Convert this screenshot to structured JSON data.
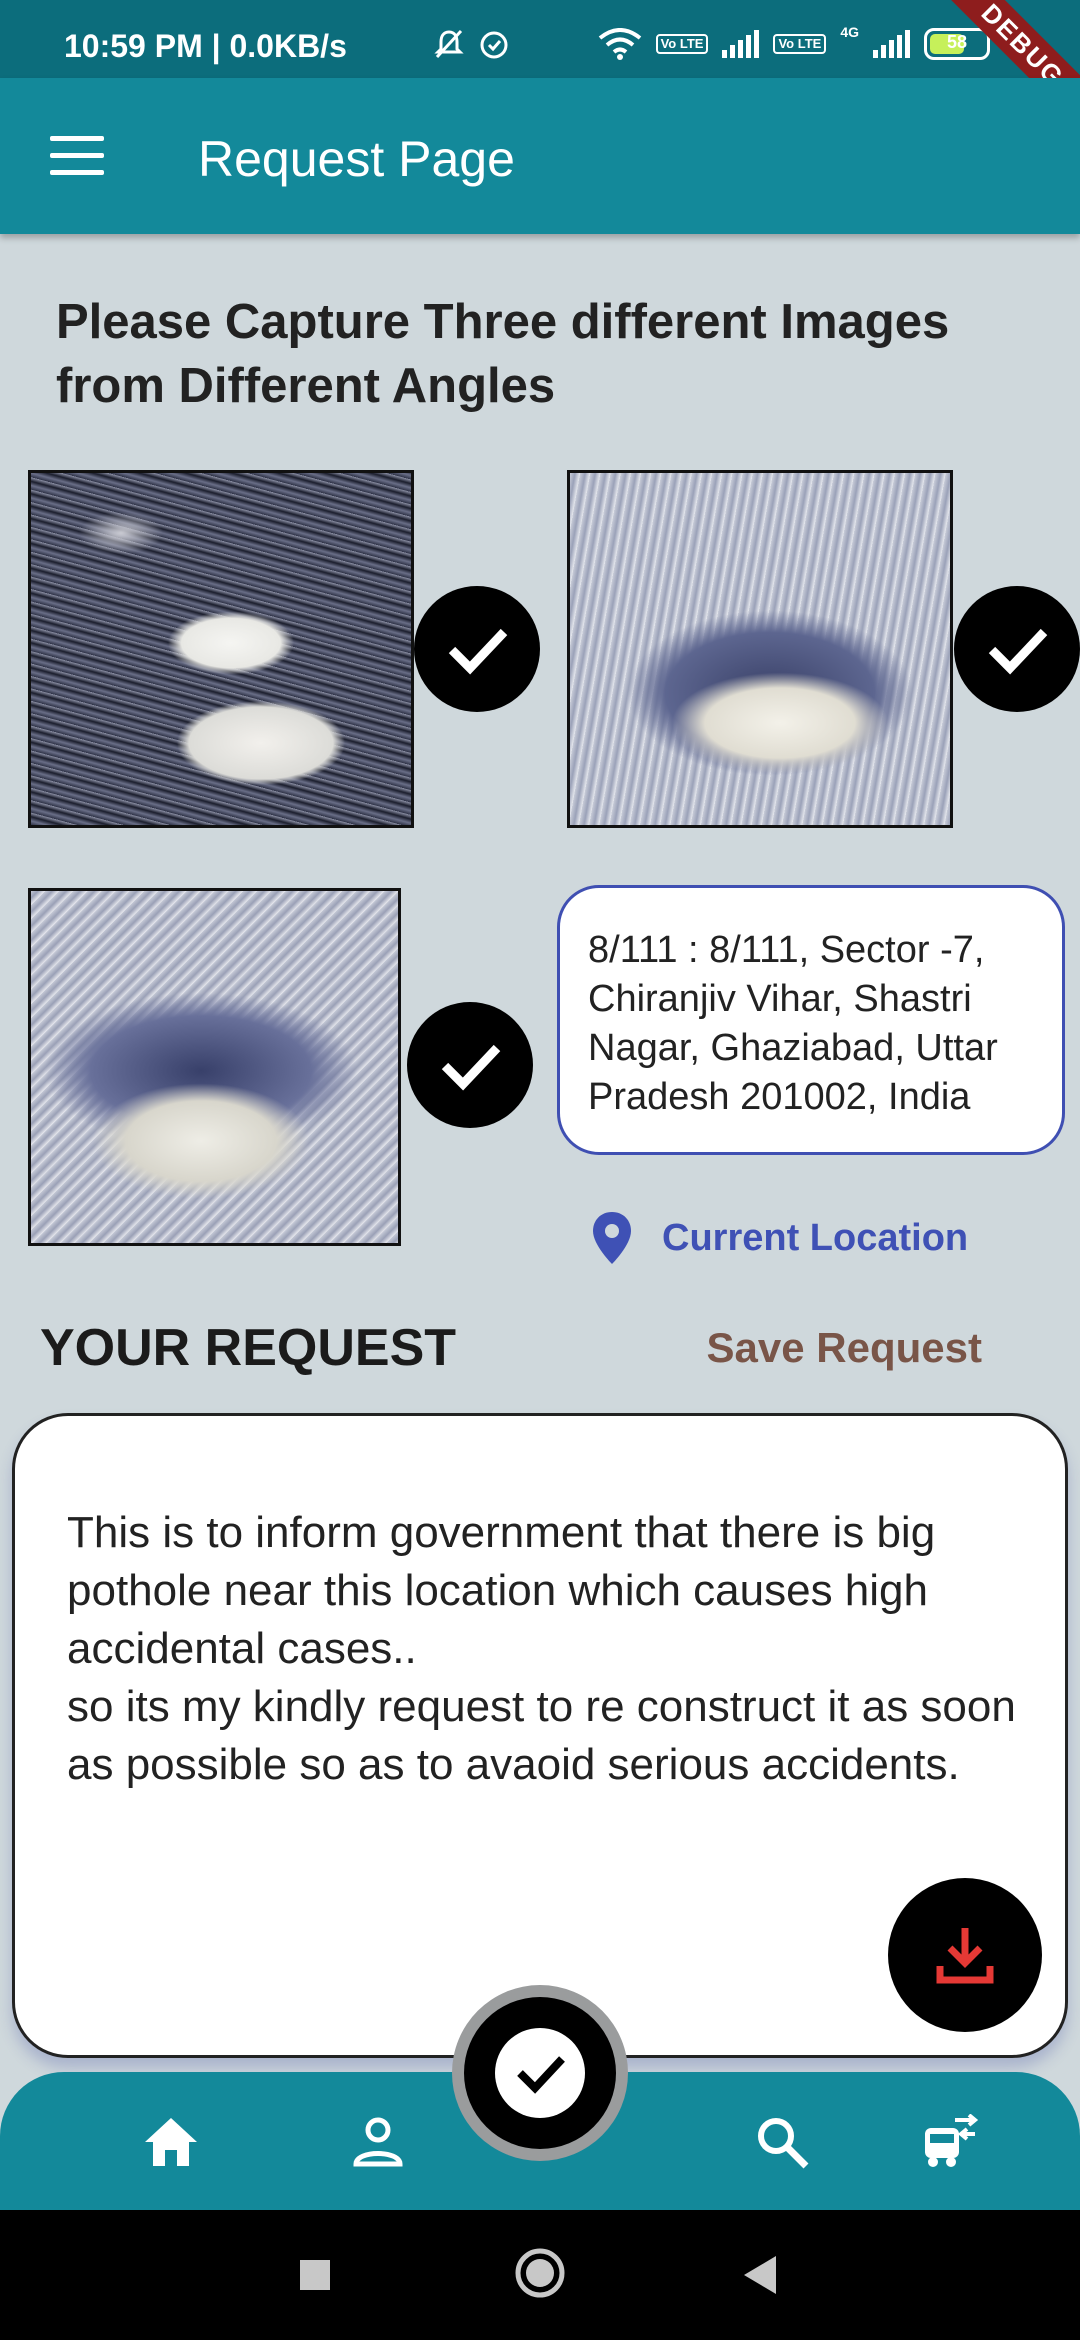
{
  "status_bar": {
    "time_text": "10:59 PM | 0.0KB/s",
    "volte_label": "Vo LTE",
    "network_4g_label": "4G",
    "battery_level": "58",
    "debug_label": "DEBUG"
  },
  "app_bar": {
    "title": "Request Page"
  },
  "capture": {
    "instruction": "Please Capture Three different Images from Different Angles",
    "images_captured": 3
  },
  "location": {
    "address": "8/111 : 8/111, Sector -7, Chiranjiv Vihar, Shastri Nagar, Ghaziabad, Uttar Pradesh 201002, India",
    "button_label": "Current Location"
  },
  "request": {
    "heading": "YOUR REQUEST",
    "save_label": "Save Request",
    "line1": "This is to inform government that there is big pothole near this location which causes high accidental cases..",
    "line2": "so its my kindly request to re construct it as soon as possible so as to avaoid serious accidents."
  },
  "colors": {
    "status_bar": "#0c6d7c",
    "app_bar": "#13899a",
    "background": "#cfd8dc",
    "accent_blue": "#3f51b5",
    "save_brown": "#795548",
    "download_red": "#e53935"
  },
  "icons": {
    "menu": "menu-icon",
    "check": "check-icon",
    "location": "location-pin-icon",
    "download": "download-icon",
    "home": "home-icon",
    "profile": "person-icon",
    "search": "search-icon",
    "transport": "transport-icon"
  }
}
